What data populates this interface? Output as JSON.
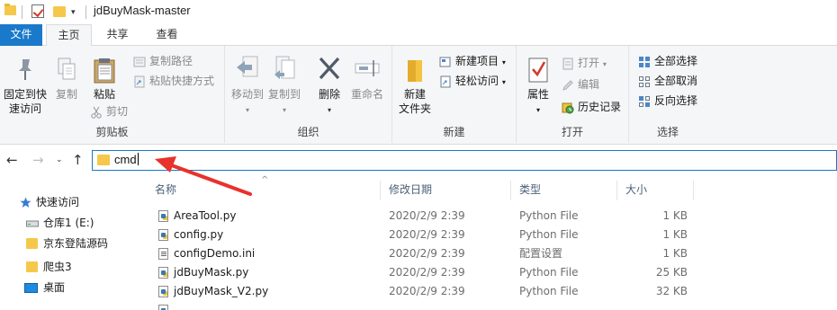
{
  "window": {
    "title": "jdBuyMask-master"
  },
  "tabs": [
    {
      "label": "文件"
    },
    {
      "label": "主页"
    },
    {
      "label": "共享"
    },
    {
      "label": "查看"
    }
  ],
  "ribbon": {
    "clipboard": {
      "pin_label_1": "固定到快",
      "pin_label_2": "速访问",
      "copy_label": "复制",
      "paste_label": "粘贴",
      "copy_path_label": "复制路径",
      "paste_shortcut_label": "粘贴快捷方式",
      "cut_label": "剪切",
      "group_label": "剪贴板"
    },
    "organize": {
      "move_to_label": "移动到",
      "copy_to_label": "复制到",
      "delete_label": "删除",
      "rename_label": "重命名",
      "group_label": "组织"
    },
    "new": {
      "new_folder_label_1": "新建",
      "new_folder_label_2": "文件夹",
      "new_item_label": "新建项目",
      "easy_access_label": "轻松访问",
      "group_label": "新建"
    },
    "open": {
      "properties_label": "属性",
      "open_label": "打开",
      "edit_label": "编辑",
      "history_label": "历史记录",
      "group_label": "打开"
    },
    "select": {
      "select_all_label": "全部选择",
      "select_none_label": "全部取消",
      "invert_label": "反向选择",
      "group_label": "选择"
    }
  },
  "address_bar": {
    "value": "cmd"
  },
  "nav_pane": {
    "items": [
      {
        "label": "快速访问",
        "icon": "star-icon"
      },
      {
        "label": "仓库1 (E:)",
        "icon": "drive-icon"
      },
      {
        "label": "京东登陆源码",
        "icon": "folder-icon"
      },
      {
        "label": "爬虫3",
        "icon": "folder-icon"
      },
      {
        "label": "桌面",
        "icon": "desktop-icon"
      }
    ]
  },
  "file_list": {
    "columns": [
      "名称",
      "修改日期",
      "类型",
      "大小"
    ],
    "rows": [
      {
        "name": "AreaTool.py",
        "date": "2020/2/9 2:39",
        "type": "Python File",
        "size": "1 KB"
      },
      {
        "name": "config.py",
        "date": "2020/2/9 2:39",
        "type": "Python File",
        "size": "1 KB"
      },
      {
        "name": "configDemo.ini",
        "date": "2020/2/9 2:39",
        "type": "配置设置",
        "size": "1 KB"
      },
      {
        "name": "jdBuyMask.py",
        "date": "2020/2/9 2:39",
        "type": "Python File",
        "size": "25 KB"
      },
      {
        "name": "jdBuyMask_V2.py",
        "date": "2020/2/9 2:39",
        "type": "Python File",
        "size": "32 KB"
      }
    ]
  },
  "colors": {
    "accent": "#1979ca",
    "annotation_arrow": "#e8322b"
  }
}
